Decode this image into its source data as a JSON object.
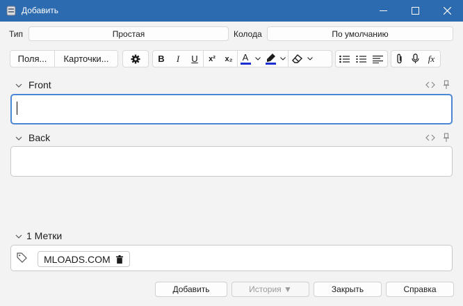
{
  "window": {
    "title": "Добавить"
  },
  "colors": {
    "titlebar": "#2c6bb0",
    "focus": "#4a86d4",
    "font_color_underline": "#1b2fd1",
    "highlight_underline": "#1b2fd1"
  },
  "type_row": {
    "type_label": "Тип",
    "type_value": "Простая",
    "deck_label": "Колода",
    "deck_value": "По умолчанию"
  },
  "toolbar": {
    "fields_label": "Поля...",
    "cards_label": "Карточки...",
    "icons": [
      "gear-icon",
      "bold-icon",
      "italic-icon",
      "underline-icon",
      "superscript-icon",
      "subscript-icon",
      "text-color-icon",
      "highlight-icon",
      "eraser-icon",
      "bullet-list-icon",
      "numbered-list-icon",
      "align-icon",
      "paperclip-icon",
      "microphone-icon",
      "formula-icon"
    ],
    "bold": "B",
    "italic": "I",
    "underline": "U",
    "superscript": "x²",
    "subscript": "x₂",
    "text_color": "A",
    "formula": "fx"
  },
  "fields": [
    {
      "name": "Front",
      "value": ""
    },
    {
      "name": "Back",
      "value": ""
    }
  ],
  "tags": {
    "header": "1 Метки",
    "items": [
      "MLOADS.COM"
    ]
  },
  "buttons": {
    "add": "Добавить",
    "history": "История ▼",
    "close": "Закрыть",
    "help": "Справка"
  }
}
